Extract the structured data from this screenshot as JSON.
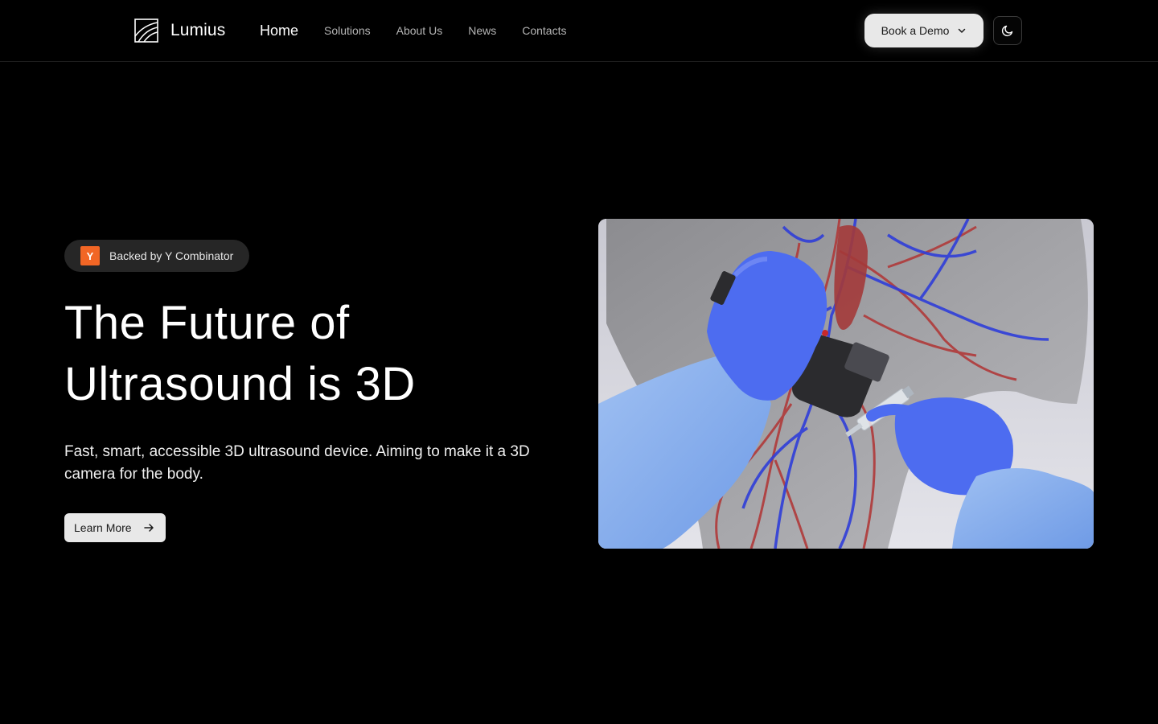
{
  "brand": {
    "name": "Lumius"
  },
  "nav": {
    "items": [
      {
        "label": "Home",
        "active": true
      },
      {
        "label": "Solutions",
        "active": false
      },
      {
        "label": "About Us",
        "active": false
      },
      {
        "label": "News",
        "active": false
      },
      {
        "label": "Contacts",
        "active": false
      }
    ]
  },
  "header": {
    "demo_label": "Book a Demo",
    "demo_icon": "chevron-down-icon",
    "theme_icon": "moon-icon"
  },
  "hero": {
    "badge": {
      "logo_letter": "Y",
      "logo_color": "#f26625",
      "text": "Backed by Y Combinator"
    },
    "title_line1": "The Future of",
    "title_line2": "Ultrasound is 3D",
    "subtitle": "Fast, smart, accessible 3D ultrasound device. Aiming to make it a 3D camera for the body.",
    "cta_label": "Learn More",
    "cta_icon": "arrow-right-icon"
  },
  "colors": {
    "background": "#000000",
    "button_bg": "#e8e8e8",
    "glove_blue": "#4d6cf0",
    "gown_blue": "#7fa9ec"
  }
}
